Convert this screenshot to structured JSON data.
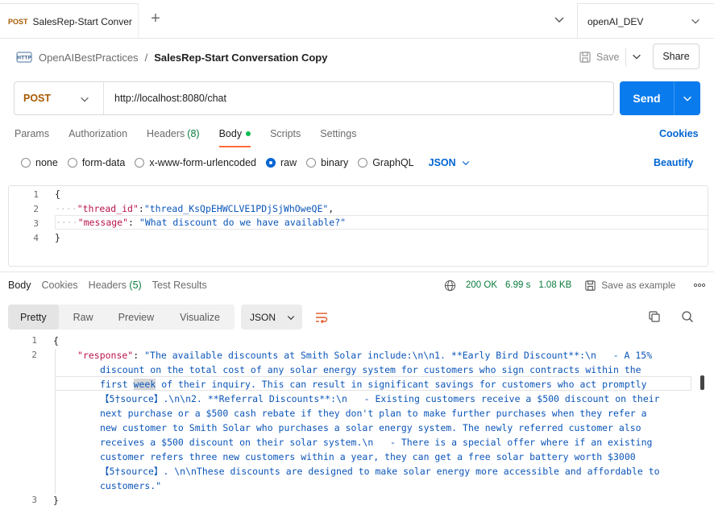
{
  "tabbar": {
    "tab": {
      "method": "POST",
      "title": "SalesRep-Start Conver"
    },
    "add_label": "+",
    "environment": "openAI_DEV"
  },
  "breadcrumb": {
    "parent": "OpenAIBestPractices",
    "separator": "/",
    "current": "SalesRep-Start Conversation Copy",
    "save_label": "Save",
    "share_label": "Share"
  },
  "request": {
    "method": "POST",
    "url": "http://localhost:8080/chat",
    "send_label": "Send"
  },
  "request_tabs": {
    "params": "Params",
    "authorization": "Authorization",
    "headers": "Headers",
    "headers_count": "(8)",
    "body": "Body",
    "scripts": "Scripts",
    "settings": "Settings",
    "cookies": "Cookies"
  },
  "body_types": {
    "none": "none",
    "form_data": "form-data",
    "urlencoded": "x-www-form-urlencoded",
    "raw": "raw",
    "binary": "binary",
    "graphql": "GraphQL",
    "format": "JSON",
    "beautify": "Beautify"
  },
  "request_body": {
    "line_numbers": [
      "1",
      "2",
      "3",
      "4"
    ],
    "open": "{",
    "thread_key": "\"thread_id\"",
    "thread_value": "\"thread_KsQpEHWCLVE1PDjSjWhOweQE\"",
    "message_key": "\"message\"",
    "message_value": "\"What discount do we have available?\"",
    "close": "}",
    "colon": ":",
    "comma": ",",
    "indent": "····"
  },
  "response_tabs": {
    "body": "Body",
    "cookies": "Cookies",
    "headers": "Headers",
    "headers_count": "(5)",
    "test_results": "Test Results"
  },
  "response_meta": {
    "status": "200 OK",
    "time": "6.99 s",
    "size": "1.08 KB",
    "save_example": "Save as example"
  },
  "response_toolbar": {
    "pretty": "Pretty",
    "raw": "Raw",
    "preview": "Preview",
    "visualize": "Visualize",
    "format": "JSON"
  },
  "response_body": {
    "line_numbers": [
      "1",
      "2",
      "3"
    ],
    "open": "{",
    "key": "\"response\"",
    "colon": ": ",
    "lines": [
      "\"The available discounts at Smith Solar include:\\n\\n1. **Early Bird Discount**:\\n   - A 15%",
      "discount on the total cost of any solar energy system for customers who sign contracts within the",
      "of their inquiry. This can result in significant savings for customers who act promptly",
      "【5†source】.\\n\\n2. **Referral Discounts**:\\n   - Existing customers receive a $500 discount on their",
      "next purchase or a $500 cash rebate if they don't plan to make further purchases when they refer a",
      "new customer to Smith Solar who purchases a solar energy system. The newly referred customer also",
      "receives a $500 discount on their solar system.\\n   - There is a special offer where if an existing",
      "customer refers three new customers within a year, they can get a free solar battery worth $3000",
      "【5†source】. \\n\\nThese discounts are designed to make solar energy more accessible and affordable to",
      "customers.\""
    ],
    "line3_prefix": "first ",
    "line3_highlight": "week",
    "close": "}"
  }
}
